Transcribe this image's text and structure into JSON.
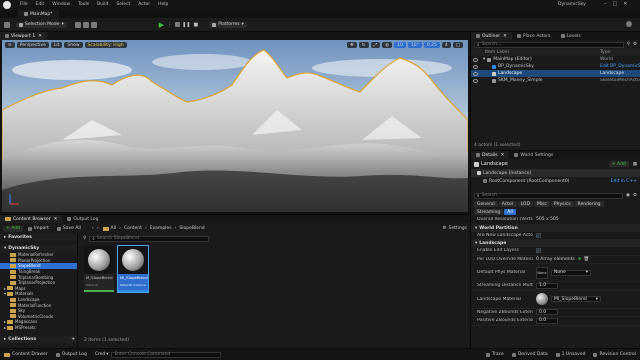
{
  "app": {
    "map_tab": "MainMap*",
    "project_name": "DynamicSky",
    "menu": [
      "File",
      "Edit",
      "Window",
      "Tools",
      "Build",
      "Select",
      "Actor",
      "Help"
    ]
  },
  "toolbar": {
    "save_label": "",
    "mode_label": "Selection Mode",
    "platforms_label": "Platforms"
  },
  "viewport": {
    "tab_label": "Viewport 1",
    "perspective_label": "Perspective",
    "lit_label": "Lit",
    "show_label": "Show",
    "scalability_label": "Scalability: High",
    "snap_values": [
      "10",
      "10°",
      "0.25",
      "4"
    ]
  },
  "outliner": {
    "tab_label": "Outliner",
    "place_actors_label": "Place Actors",
    "levels_label": "Levels",
    "search_placeholder": "Search...",
    "col_label": "Item Label",
    "col_type": "Type",
    "rows": [
      {
        "label": "MainMap (Editor)",
        "type": "World",
        "indent": 0,
        "selected": false
      },
      {
        "label": "BP_DynamicSky",
        "type": "Edit BP_DynamicSky",
        "indent": 1,
        "selected": false
      },
      {
        "label": "Landscape",
        "type": "Landscape",
        "indent": 1,
        "selected": true
      },
      {
        "label": "SKM_Manny_Simple",
        "type": "SkeletalMeshActor",
        "indent": 1,
        "selected": false
      }
    ],
    "status": "4 actors (1 selected)"
  },
  "details": {
    "tab_label": "Details",
    "world_settings_label": "World Settings",
    "actor_name": "Landscape",
    "add_label": "+ Add",
    "instance_label": "Landscape (Instance)",
    "root_component_label": "RootComponent (RootComponent0)",
    "edit_cpp_label": "Edit in C++",
    "search_placeholder": "Search",
    "filters_row1": [
      "General",
      "Actor",
      "LOD",
      "Misc",
      "Physics",
      "Rendering"
    ],
    "filters_row2": [
      "Streaming",
      "All"
    ],
    "overall_resolution_label": "Overall Resolution (Verts)",
    "overall_resolution_value": "505 x 505",
    "partition_cat": "World Partition",
    "partition_prop_label": "Are New Landscape Actors Spati...",
    "landscape_cat": "Landscape",
    "props": {
      "edit_layers": "Enable Edit Layers",
      "lod0_materials": "Per LOD Override Materials",
      "lod0_value": "0 Array elements",
      "default_phys": "Default Phys Material",
      "default_phys_value": "None",
      "streaming_distance": "Streaming Distance Multiplier",
      "streaming_distance_value": "1.0",
      "landscape_material": "Landscape Material",
      "landscape_material_value": "MI_SlopeBlend",
      "negative_z": "Negative ZBounds Extension",
      "negative_z_value": "0.0",
      "positive_z": "Positive ZBounds Extension",
      "positive_z_value": "0.0"
    },
    "none_label": "None"
  },
  "content_browser": {
    "tab_label": "Content Browser",
    "output_log_label": "Output Log",
    "add_label": "+ Add",
    "import_label": "Import",
    "save_all_label": "Save All",
    "breadcrumb": [
      "All",
      "Content",
      "Examples",
      "SlopeBlend"
    ],
    "settings_label": "Settings",
    "favorites_label": "Favorites",
    "project_label": "DynamicSky",
    "search_placeholder": "Search SlopeBlend",
    "tree": [
      {
        "label": "MaterialRefresher",
        "indent": 2
      },
      {
        "label": "PlanarProjection",
        "indent": 2
      },
      {
        "label": "SlopeBlend",
        "indent": 2,
        "selected": true
      },
      {
        "label": "TilingBreak",
        "indent": 2
      },
      {
        "label": "TriplanarBombing",
        "indent": 2
      },
      {
        "label": "TriplanarProjection",
        "indent": 2
      },
      {
        "label": "Maps",
        "indent": 1
      },
      {
        "label": "Materials",
        "indent": 1
      },
      {
        "label": "Landscape",
        "indent": 2
      },
      {
        "label": "MaterialFunction",
        "indent": 2
      },
      {
        "label": "Sky",
        "indent": 2
      },
      {
        "label": "VolumetricClouds",
        "indent": 2
      },
      {
        "label": "Megascans",
        "indent": 1
      },
      {
        "label": "MSPresets",
        "indent": 1
      }
    ],
    "collections_label": "Collections",
    "assets": [
      {
        "name": "M_SlopeBlend",
        "type": "Material",
        "color": "#4caf50",
        "selected": false
      },
      {
        "name": "MI_SlopeBlend",
        "type": "Material Instance",
        "color": "#2e8be6",
        "selected": true
      }
    ],
    "status": "2 items (1 selected)"
  },
  "statusbar": {
    "content_drawer": "Content Drawer",
    "output_log": "Output Log",
    "cmd_label": "Cmd",
    "console_placeholder": "Enter Console Command",
    "trace_label": "Trace",
    "derived_data_label": "Derived Data",
    "unsaved_label": "1 Unsaved",
    "revision_label": "Revision Control"
  },
  "colors": {
    "accent_blue": "#2e8be6",
    "selection": "#1d4a7a",
    "play_green": "#3fbf3f"
  }
}
